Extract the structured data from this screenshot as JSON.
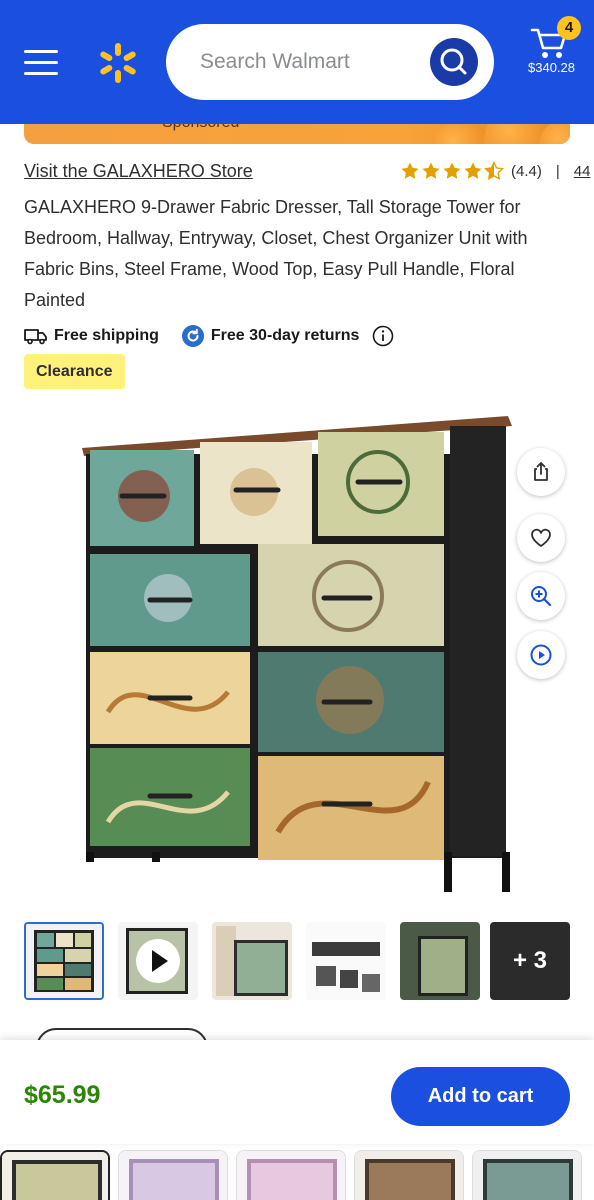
{
  "header": {
    "search_placeholder": "Search Walmart",
    "cart_count": "4",
    "cart_total": "$340.28",
    "menu_icon": "hamburger-icon",
    "logo_icon": "walmart-spark-icon",
    "search_icon": "search-icon",
    "cart_icon": "cart-icon",
    "brand_color": "#1a4fe0",
    "badge_color": "#ffc220"
  },
  "ad": {
    "sponsored_text": "Sponsored"
  },
  "product": {
    "store_link": "Visit the GALAXHERO Store",
    "rating_value": "(4.4)",
    "rating_separator": "|",
    "review_count": "44",
    "rating_stars": 4.4,
    "title": "GALAXHERO 9-Drawer Fabric Dresser, Tall Storage Tower for Bedroom, Hallway, Entryway, Closet, Chest Organizer Unit with Fabric Bins, Steel Frame, Wood Top, Easy Pull Handle, Floral Painted",
    "shipping_label": "Free shipping",
    "returns_label": "Free 30-day returns",
    "clearance_label": "Clearance",
    "price": "$65.99",
    "price_color": "#2a8703"
  },
  "gallery": {
    "more_label": "+ 3",
    "thumbnail_count": 6,
    "selected_index": 0
  },
  "actions": {
    "add_to_cart": "Add to cart",
    "share_icon": "share-icon",
    "favorite_icon": "heart-icon",
    "zoom_icon": "zoom-in-icon",
    "video_icon": "play-circle-icon"
  }
}
